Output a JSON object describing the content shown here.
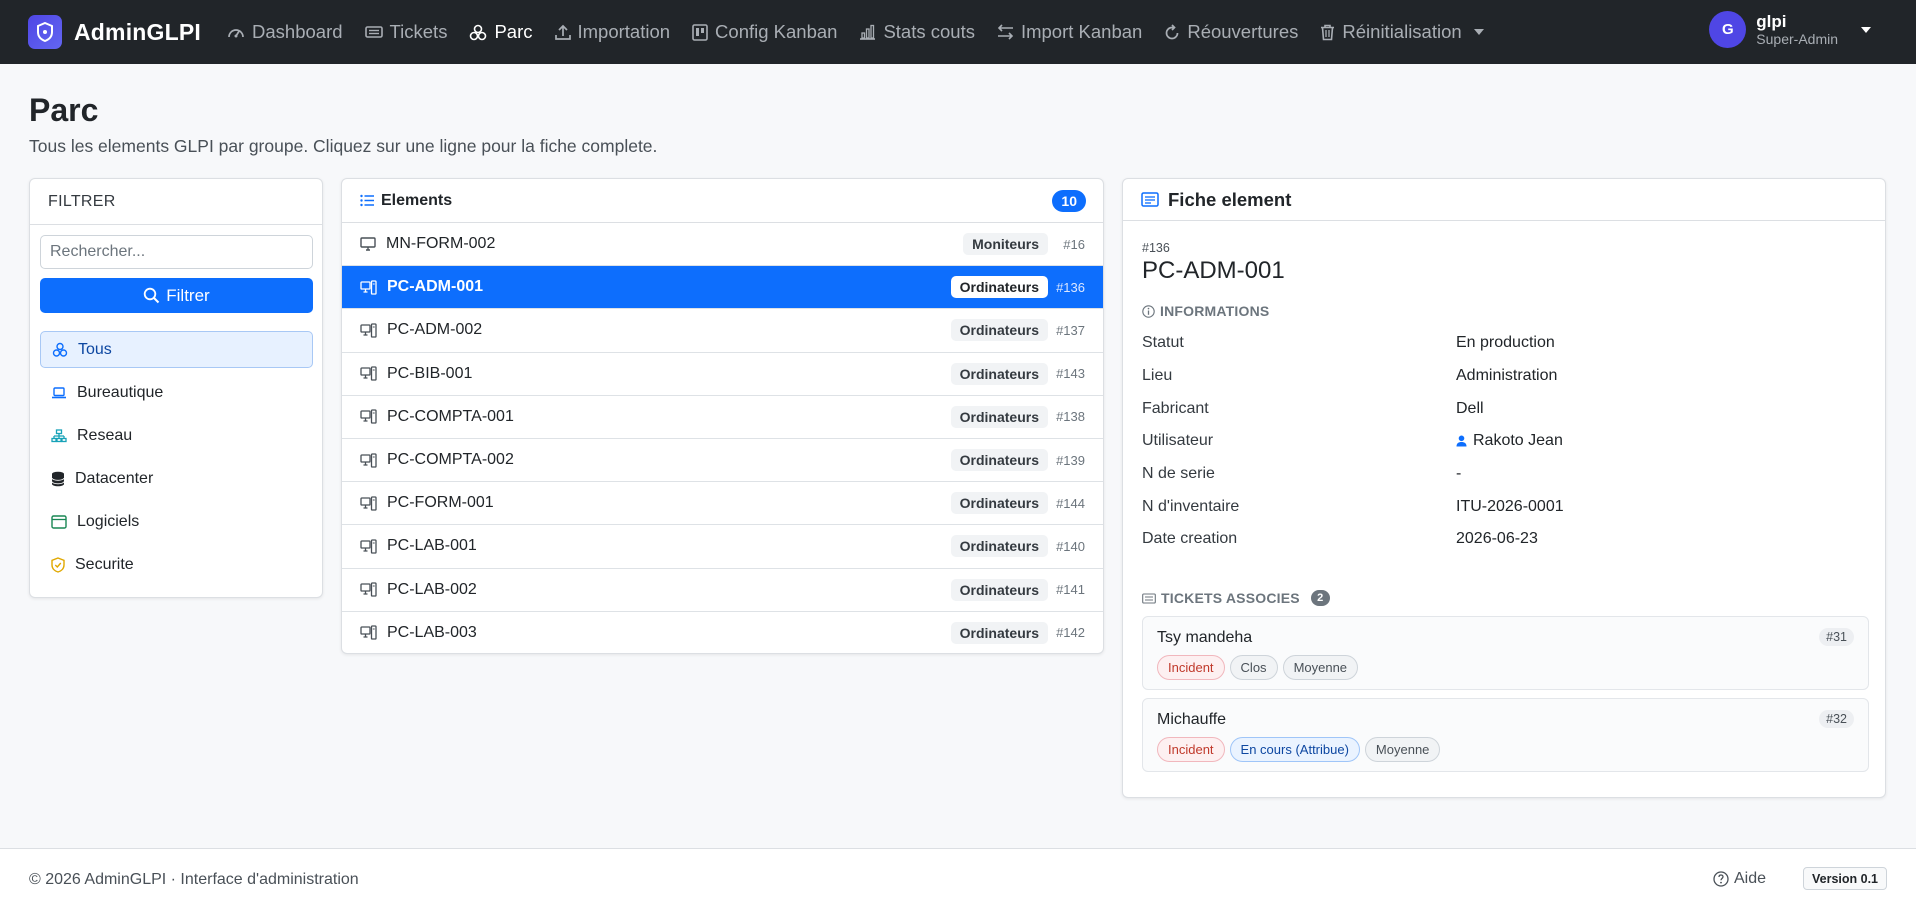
{
  "navbar": {
    "brand": "AdminGLPI",
    "items": [
      {
        "label": "Dashboard",
        "icon": "speedometer-icon",
        "active": false
      },
      {
        "label": "Tickets",
        "icon": "ticket-icon",
        "active": false
      },
      {
        "label": "Parc",
        "icon": "boxes-icon",
        "active": true
      },
      {
        "label": "Importation",
        "icon": "upload-icon",
        "active": false
      },
      {
        "label": "Config Kanban",
        "icon": "kanban-icon",
        "active": false
      },
      {
        "label": "Stats couts",
        "icon": "bar-chart-icon",
        "active": false
      },
      {
        "label": "Import Kanban",
        "icon": "arrows-exchange-icon",
        "active": false
      },
      {
        "label": "Réouvertures",
        "icon": "reopen-arrow-icon",
        "active": false
      },
      {
        "label": "Réinitialisation",
        "icon": "trash-icon",
        "active": false
      }
    ],
    "user": {
      "initial": "G",
      "name": "glpi",
      "role": "Super-Admin"
    }
  },
  "header": {
    "title": "Parc",
    "subtitle": "Tous les elements GLPI par groupe. Cliquez sur une ligne pour la fiche complete."
  },
  "filter": {
    "heading": "FILTRER",
    "search_placeholder": "Rechercher...",
    "search_value": "",
    "button_label": "Filtrer",
    "groups": [
      {
        "label": "Tous",
        "icon": "diagram-icon",
        "active": true
      },
      {
        "label": "Bureautique",
        "icon": "laptop-icon",
        "active": false
      },
      {
        "label": "Reseau",
        "icon": "network-icon",
        "active": false
      },
      {
        "label": "Datacenter",
        "icon": "database-icon",
        "active": false
      },
      {
        "label": "Logiciels",
        "icon": "window-icon",
        "active": false
      },
      {
        "label": "Securite",
        "icon": "shield-icon",
        "active": false
      }
    ]
  },
  "elements": {
    "heading": "Elements",
    "count": "10",
    "rows": [
      {
        "name": "MN-FORM-002",
        "type": "Moniteurs",
        "id": "#16",
        "icon": "monitor-icon",
        "selected": false
      },
      {
        "name": "PC-ADM-001",
        "type": "Ordinateurs",
        "id": "#136",
        "icon": "pc-tower-icon",
        "selected": true
      },
      {
        "name": "PC-ADM-002",
        "type": "Ordinateurs",
        "id": "#137",
        "icon": "pc-tower-icon",
        "selected": false
      },
      {
        "name": "PC-BIB-001",
        "type": "Ordinateurs",
        "id": "#143",
        "icon": "pc-tower-icon",
        "selected": false
      },
      {
        "name": "PC-COMPTA-001",
        "type": "Ordinateurs",
        "id": "#138",
        "icon": "pc-tower-icon",
        "selected": false
      },
      {
        "name": "PC-COMPTA-002",
        "type": "Ordinateurs",
        "id": "#139",
        "icon": "pc-tower-icon",
        "selected": false
      },
      {
        "name": "PC-FORM-001",
        "type": "Ordinateurs",
        "id": "#144",
        "icon": "pc-tower-icon",
        "selected": false
      },
      {
        "name": "PC-LAB-001",
        "type": "Ordinateurs",
        "id": "#140",
        "icon": "pc-tower-icon",
        "selected": false
      },
      {
        "name": "PC-LAB-002",
        "type": "Ordinateurs",
        "id": "#141",
        "icon": "pc-tower-icon",
        "selected": false
      },
      {
        "name": "PC-LAB-003",
        "type": "Ordinateurs",
        "id": "#142",
        "icon": "pc-tower-icon",
        "selected": false
      }
    ]
  },
  "fiche": {
    "heading": "Fiche element",
    "id": "#136",
    "name": "PC-ADM-001",
    "info_heading": "INFORMATIONS",
    "info": [
      {
        "label": "Statut",
        "value": "En production"
      },
      {
        "label": "Lieu",
        "value": "Administration"
      },
      {
        "label": "Fabricant",
        "value": "Dell"
      },
      {
        "label": "Utilisateur",
        "value": "Rakoto Jean",
        "icon": "person-icon"
      },
      {
        "label": "N de serie",
        "value": "-"
      },
      {
        "label": "N d'inventaire",
        "value": "ITU-2026-0001"
      },
      {
        "label": "Date creation",
        "value": "2026-06-23"
      }
    ],
    "tickets_heading": "TICKETS ASSOCIES",
    "tickets_count": "2",
    "tickets": [
      {
        "title": "Tsy mandeha",
        "id": "#31",
        "type": "Incident",
        "status": "Clos",
        "priority": "Moyenne"
      },
      {
        "title": "Michauffe",
        "id": "#32",
        "type": "Incident",
        "status": "En cours (Attribue)",
        "priority": "Moyenne"
      }
    ]
  },
  "footer": {
    "copyright": "© 2026 AdminGLPI · Interface d'administration",
    "help": "Aide",
    "version": "Version 0.1"
  },
  "colors": {
    "navbar_bg": "#212529",
    "brand": "#4f46e5",
    "primary": "#0d6efd",
    "incident": "#c0392b"
  }
}
